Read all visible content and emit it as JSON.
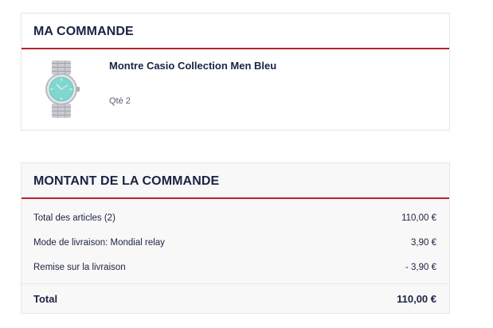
{
  "order": {
    "title": "MA COMMANDE",
    "product": {
      "name": "Montre Casio Collection Men Bleu",
      "qty": "Qté 2",
      "image_icon": "watch-image"
    }
  },
  "amount": {
    "title": "MONTANT DE LA COMMANDE",
    "rows": [
      {
        "label": "Total des articles (2)",
        "value": "110,00 €"
      },
      {
        "label": "Mode de livraison: Mondial relay",
        "value": "3,90 €"
      },
      {
        "label": "Remise sur la livraison",
        "value": "- 3,90 €"
      }
    ],
    "total": {
      "label": "Total",
      "value": "110,00 €"
    }
  },
  "colors": {
    "accent": "#b5232f",
    "heading": "#1c2244",
    "dial": "#7fd8d0"
  }
}
